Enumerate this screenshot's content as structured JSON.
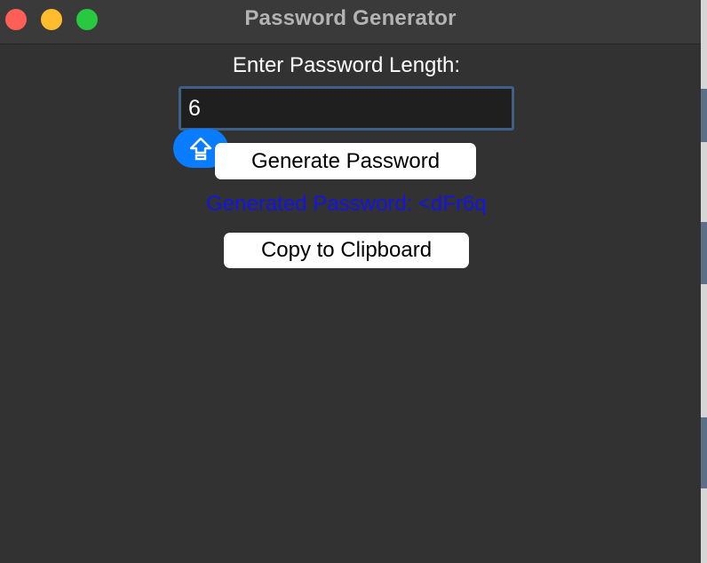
{
  "window": {
    "title": "Password Generator"
  },
  "form": {
    "length_label": "Enter Password Length:",
    "length_value": "6",
    "generate_label": "Generate Password",
    "result_text": "Generated Password: <dFr6q",
    "copy_label": "Copy to Clipboard"
  },
  "icons": {
    "input_badge": "shift-arrow-icon"
  },
  "colors": {
    "window_background": "#323232",
    "titlebar": "#3a3a3a",
    "result_text": "#1414e6",
    "input_focus_border": "#3f5f86",
    "badge": "#0a7cff"
  }
}
